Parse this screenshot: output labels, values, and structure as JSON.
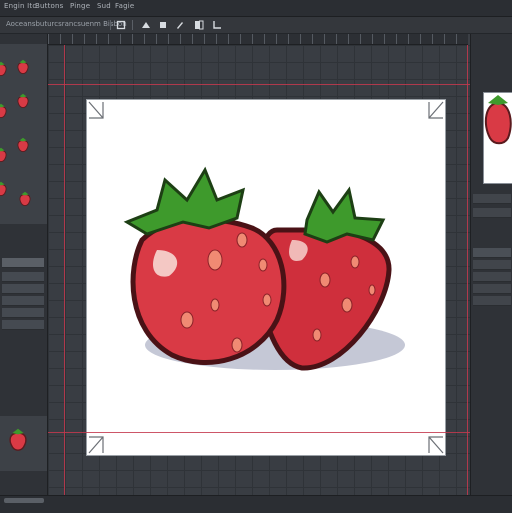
{
  "menubar": {
    "items": [
      "Engin Itc",
      "Buttons",
      "Pinge",
      "Sud",
      "Fagie"
    ]
  },
  "toolbar": {
    "label": "Aoceansbuturcsrancsuenm Bisbon"
  },
  "icons": {
    "toolbar": [
      "square-icon",
      "blend-icon",
      "fill-icon",
      "brush-icon",
      "layers-icon",
      "crop-icon"
    ],
    "right_panel": [
      "search-icon",
      "shield-icon",
      "eye-icon"
    ]
  },
  "colors": {
    "app_background": "#3b3f45",
    "canvas": "#ffffff",
    "guide": "#c4384d",
    "strawberry_red": "#d93a45",
    "leaf_green": "#3e9a2c"
  }
}
